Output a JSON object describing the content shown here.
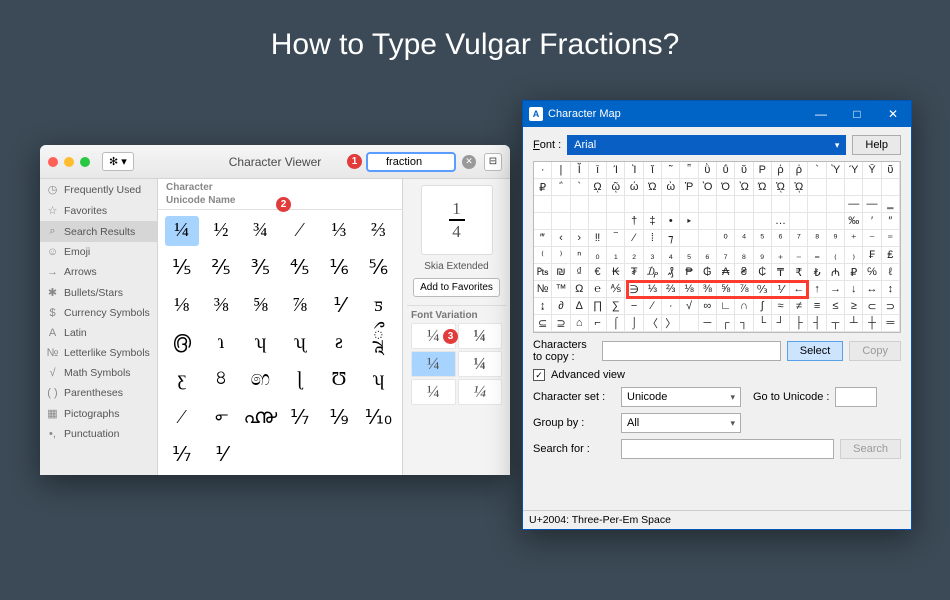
{
  "page_title": "How to Type Vulgar Fractions?",
  "callouts": [
    "1",
    "2",
    "3"
  ],
  "mac": {
    "window_title": "Character Viewer",
    "gear_glyph": "✻ ▾",
    "search_value": "fraction",
    "search_icon": "⌕",
    "sidebar": [
      {
        "icon": "◷",
        "label": "Frequently Used"
      },
      {
        "icon": "☆",
        "label": "Favorites"
      },
      {
        "icon": "⌕",
        "label": "Search Results",
        "selected": true
      },
      {
        "icon": "☺",
        "label": "Emoji"
      },
      {
        "icon": "→",
        "label": "Arrows"
      },
      {
        "icon": "✱",
        "label": "Bullets/Stars"
      },
      {
        "icon": "$",
        "label": "Currency Symbols"
      },
      {
        "icon": "A",
        "label": "Latin"
      },
      {
        "icon": "№",
        "label": "Letterlike Symbols"
      },
      {
        "icon": "√",
        "label": "Math Symbols"
      },
      {
        "icon": "( )",
        "label": "Parentheses"
      },
      {
        "icon": "▦",
        "label": "Pictographs"
      },
      {
        "icon": "•,",
        "label": "Punctuation"
      }
    ],
    "grid_header": {
      "col1": "Character",
      "col2": "Unicode Name"
    },
    "chars": [
      "¼",
      "½",
      "¾",
      "⁄",
      "⅓",
      "⅔",
      "⅕",
      "⅖",
      "⅗",
      "⅘",
      "⅙",
      "⅚",
      "⅛",
      "⅜",
      "⅝",
      "⅞",
      "⅟",
      "ƽ",
      "൫",
      "ɿ",
      "ʮ",
      "ʯ",
      "ƨ",
      "ཷ",
      "ƹ",
      "৪",
      "෨",
      "ɭ",
      "Ʊ",
      "ʮ",
      "⁄",
      "൳",
      "൷",
      "⅐",
      "⅑",
      "⅒",
      "⅐",
      "⅟",
      ""
    ],
    "preview_font": "Skia Extended",
    "add_favorites": "Add to Favorites",
    "font_variation_label": "Font Variation",
    "font_variations": [
      "¼",
      "¼",
      "¼",
      "¼",
      "¼",
      "¼"
    ]
  },
  "win": {
    "window_title": "Character Map",
    "font_label": "Font :",
    "font_value": "Arial",
    "help_label": "Help",
    "grid_rows": [
      [
        "·",
        "|",
        "Ῐ",
        "ῑ",
        "Ί",
        "Ὶ",
        "ῐ",
        "῀",
        "῁",
        "ῢ",
        "ΰ",
        "ῠ",
        "Ρ",
        "ῥ",
        "ῤ",
        "`",
        "Ὺ",
        "Ύ",
        "Ῡ",
        "ῦ"
      ],
      [
        "₽",
        "΅",
        "`",
        "ῼ",
        "ῷ",
        "ώ",
        "Ώ",
        "ὼ",
        "Ῥ",
        "Ὸ",
        "Ό",
        "Ὼ",
        "Ώ",
        "ᾨ",
        "ᾩ",
        " ",
        " ",
        " ",
        " ",
        " "
      ],
      [
        " ",
        " ",
        " ",
        " ",
        " ",
        " ",
        " ",
        " ",
        " ",
        " ",
        " ",
        " ",
        " ",
        " ",
        " ",
        " ",
        " ",
        "—",
        "―",
        "‗"
      ],
      [
        " ",
        " ",
        " ",
        " ",
        " ",
        "†",
        "‡",
        "•",
        "‣",
        " ",
        " ",
        " ",
        " ",
        "…",
        " ",
        " ",
        " ",
        "‰",
        "′",
        "″"
      ],
      [
        "‴",
        "‹",
        "›",
        "‼",
        "‾",
        "⁄",
        "⁞",
        "⁊",
        " ",
        " ",
        "⁰",
        "⁴",
        "⁵",
        "⁶",
        "⁷",
        "⁸",
        "⁹",
        "⁺",
        "⁻",
        "⁼"
      ],
      [
        "⁽",
        "⁾",
        "ⁿ",
        "₀",
        "₁",
        "₂",
        "₃",
        "₄",
        "₅",
        "₆",
        "₇",
        "₈",
        "₉",
        "₊",
        "₋",
        "₌",
        "₍",
        "₎",
        "₣",
        "₤"
      ],
      [
        "₧",
        "₪",
        "₫",
        "€",
        "₭",
        "₮",
        "₯",
        "₰",
        "₱",
        "₲",
        "₳",
        "₴",
        "₵",
        "₸",
        "₹",
        "₺",
        "₼",
        "₽",
        "℅",
        "ℓ"
      ],
      [
        "№",
        "™",
        "Ω",
        "℮",
        "⅍",
        "∋",
        "⅓",
        "⅔",
        "⅛",
        "⅜",
        "⅝",
        "⅞",
        "↉",
        "⅟",
        "←",
        "↑",
        "→",
        "↓",
        "↔",
        "↕"
      ],
      [
        "↨",
        "∂",
        "∆",
        "∏",
        "∑",
        "−",
        "∕",
        "∙",
        "√",
        "∞",
        "∟",
        "∩",
        "∫",
        "≈",
        "≠",
        "≡",
        "≤",
        "≥",
        "⊂",
        "⊃"
      ],
      [
        "⊆",
        "⊇",
        "⌂",
        "⌐",
        "⌠",
        "⌡",
        "〈",
        "〉",
        " ",
        "─",
        "┌",
        "┐",
        "└",
        "┘",
        "├",
        "┤",
        "┬",
        "┴",
        "┼",
        "═"
      ]
    ],
    "chars_to_copy_label": "Characters to copy :",
    "select_label": "Select",
    "copy_label": "Copy",
    "advanced_label": "Advanced view",
    "charset_label": "Character set :",
    "charset_value": "Unicode",
    "goto_label": "Go to Unicode :",
    "groupby_label": "Group by :",
    "groupby_value": "All",
    "search_label": "Search for :",
    "search_btn": "Search",
    "status": "U+2004: Three-Per-Em Space",
    "red_box": {
      "row": 7,
      "col_start": 5,
      "col_end": 15
    }
  }
}
